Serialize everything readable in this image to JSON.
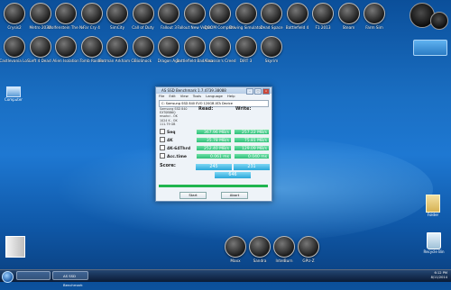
{
  "desktop": {
    "row1": [
      "Crysis2",
      "Metro 2033",
      "Wolfenstein The New Order",
      "Far Cry 4",
      "SimCity",
      "Call of Duty",
      "Fallout 3",
      "Fallout New Vegas",
      "DOOM Complete",
      "Driving Simulator",
      "Dead Space",
      "Battlefield 4",
      "F1 2013",
      "Steam",
      "Farm Sim"
    ],
    "row2": [
      "Castlevania LoS",
      "Left 4 Dead",
      "Alien Isolation",
      "Tomb Raider",
      "Batman Arkham City",
      "BioShock",
      "Dragon Age",
      "Battlefield Bad Company 2",
      "Assassin's Creed",
      "DiRT 3",
      "Skyrim"
    ],
    "recycle_label": "Recycle Bin",
    "computer_label": "Computer",
    "folder_label": "Folder",
    "dock": [
      "Maxx",
      "Sandra",
      "IntelBurn",
      "GPU-Z"
    ]
  },
  "window": {
    "title": "AS SSD Benchmark 1.7.4739.38088",
    "menu": [
      "File",
      "Edit",
      "View",
      "Tools",
      "Language",
      "Help"
    ],
    "drive": "C: Samsung SSD 840 EVO 120GB ATA Device",
    "info": [
      "Samsung SSD 840",
      "EXT0BB6Q",
      "msahci - OK",
      "1024 K - OK",
      "111.79 GB"
    ],
    "col_read": "Read:",
    "col_write": "Write:",
    "rows": [
      {
        "label": "Seq",
        "read": "367.96 MB/s",
        "write": "257.22 MB/s"
      },
      {
        "label": "4K",
        "read": "35.78 MB/s",
        "write": "75.81 MB/s"
      },
      {
        "label": "4K-64Thrd",
        "read": "252.40 MB/s",
        "write": "129.09 MB/s"
      },
      {
        "label": "Acc.time",
        "read": "0.061 ms",
        "write": "0.040 ms"
      }
    ],
    "score_label": "Score:",
    "score_read": "245",
    "score_write": "231",
    "score_total": "646",
    "progress": 1.0,
    "start_btn": "Start",
    "abort_btn": "Abort"
  },
  "taskbar": {
    "items": [
      "",
      "AS SSD Benchmark"
    ],
    "time": "6:12 PM",
    "date": "8/11/2014"
  },
  "colors": {
    "value_green": "#2fbf7a",
    "score_blue": "#2aa7d9",
    "progress": "#20b54f"
  }
}
